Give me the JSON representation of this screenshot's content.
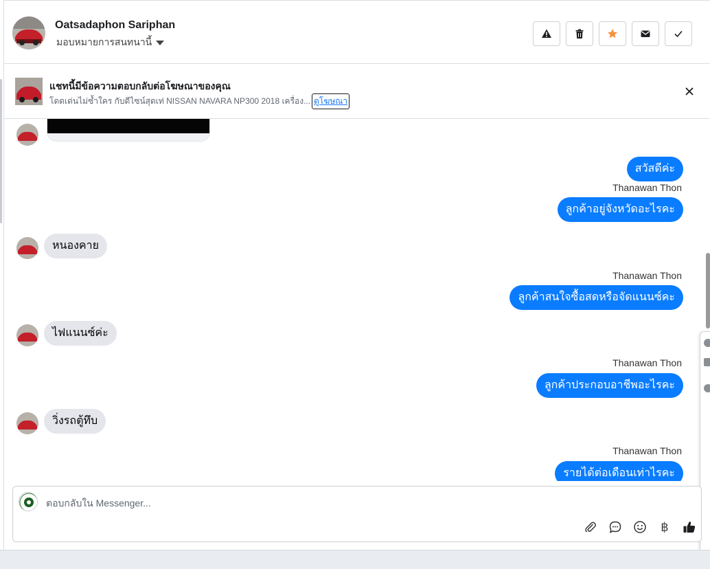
{
  "header": {
    "contact_name": "Oatsadaphon Sariphan",
    "assign_label": "มอบหมายการสนทนานี้",
    "actions": [
      "spam-icon",
      "trash-icon",
      "star-icon",
      "mail-icon",
      "check-icon"
    ]
  },
  "ad_banner": {
    "title": "แชทนี้มีข้อความตอบกลับต่อโฆษณาของคุณ",
    "description": "โดดเด่นไม่ซ้ำใคร กับดีไซน์สุดเท่ NISSAN NAVARA NP300 2018 เครื่อง...",
    "link_label": "ดูโฆษณา"
  },
  "messages": [
    {
      "dir": "out",
      "text": "สวัสดีค่ะ"
    },
    {
      "dir": "out",
      "sender": "Thanawan Thon",
      "text": "ลูกค้าอยู่จังหวัดอะไรคะ"
    },
    {
      "dir": "in",
      "text": "หนองคาย"
    },
    {
      "dir": "out",
      "sender": "Thanawan Thon",
      "text": "ลูกค้าสนใจซื้อสดหรือจัดแนนซ์คะ"
    },
    {
      "dir": "in",
      "text": "ไฟแนนซ์ค่ะ"
    },
    {
      "dir": "out",
      "sender": "Thanawan Thon",
      "text": "ลูกค้าประกอบอาชีพอะไรคะ"
    },
    {
      "dir": "in",
      "text": "วิ่งรถตู้ทึบ"
    },
    {
      "dir": "out",
      "sender": "Thanawan Thon",
      "text": "รายได้ต่อเดือนเท่าไรคะ"
    }
  ],
  "composer": {
    "placeholder": "ตอบกลับใน Messenger...",
    "tools": [
      "paperclip-icon",
      "speech-bubble-icon",
      "smiley-icon",
      "baht-icon",
      "thumbs-up-icon"
    ],
    "baht_symbol": "฿"
  },
  "colors": {
    "outgoing_bubble": "#0a7cff",
    "incoming_bubble": "#e4e6eb",
    "star": "#f7923b"
  }
}
